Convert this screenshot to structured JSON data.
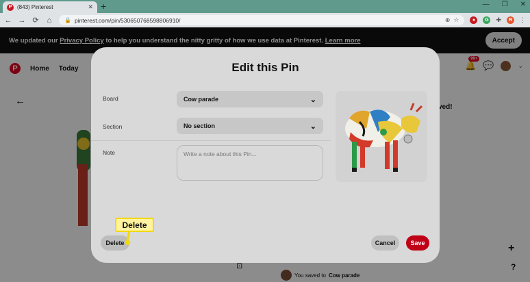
{
  "browser": {
    "tab_title": "(843) Pinterest",
    "favicon_letter": "P",
    "tab_close": "✕",
    "new_tab": "+",
    "url": "pinterest.com/pin/530650768598806910/",
    "nav": {
      "back": "←",
      "forward": "→",
      "reload": "⟳",
      "home": "⌂"
    },
    "window_controls": [
      "—",
      "❐",
      "✕"
    ],
    "profile_letter": "R"
  },
  "banner": {
    "text_before": "We updated our ",
    "link": "Privacy Policy",
    "text_after": " to help you understand the nitty gritty of how we use data at Pinterest. ",
    "learn_more": "Learn more",
    "accept": "Accept"
  },
  "header": {
    "logo": "P",
    "home": "Home",
    "today": "Today",
    "notifications_badge": "99+"
  },
  "background": {
    "saved_text": "ved!",
    "saved_to_prefix": "You saved to ",
    "saved_to_board": "Cow parade"
  },
  "modal": {
    "title": "Edit this Pin",
    "board_label": "Board",
    "board_value": "Cow parade",
    "section_label": "Section",
    "section_value": "No section",
    "note_label": "Note",
    "note_placeholder": "Write a note about this Pin...",
    "delete": "Delete",
    "cancel": "Cancel",
    "save": "Save"
  },
  "callout": {
    "text": "Delete"
  },
  "colors": {
    "pinterest_red": "#e60023",
    "save_button": "#c00016",
    "callout_fill": "#fff3a0",
    "callout_border": "#f2d900"
  }
}
